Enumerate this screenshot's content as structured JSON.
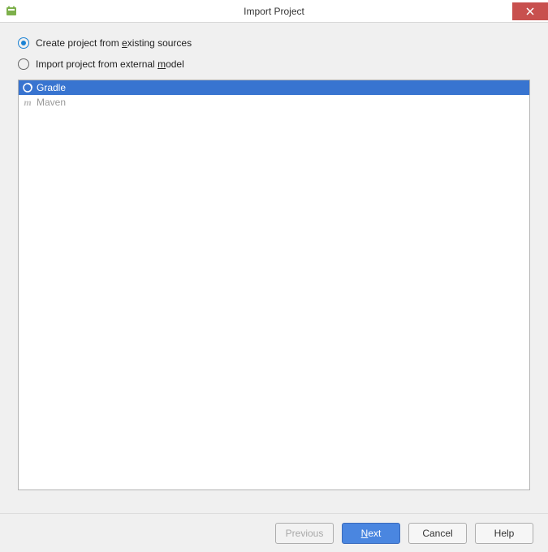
{
  "window": {
    "title": "Import Project"
  },
  "radios": {
    "create": {
      "pre": "Create project from ",
      "mnemonic": "e",
      "post": "xisting sources",
      "selected": true
    },
    "import": {
      "pre": "Import project from external ",
      "mnemonic": "m",
      "post": "odel",
      "selected": false
    }
  },
  "models": [
    {
      "name": "Gradle",
      "icon": "gradle",
      "selected": true
    },
    {
      "name": "Maven",
      "icon": "maven",
      "selected": false
    }
  ],
  "buttons": {
    "previous": {
      "label": "Previous",
      "enabled": false
    },
    "next": {
      "mnemonic": "N",
      "rest": "ext",
      "enabled": true,
      "primary": true
    },
    "cancel": {
      "label": "Cancel",
      "enabled": true
    },
    "help": {
      "label": "Help",
      "enabled": true
    }
  }
}
